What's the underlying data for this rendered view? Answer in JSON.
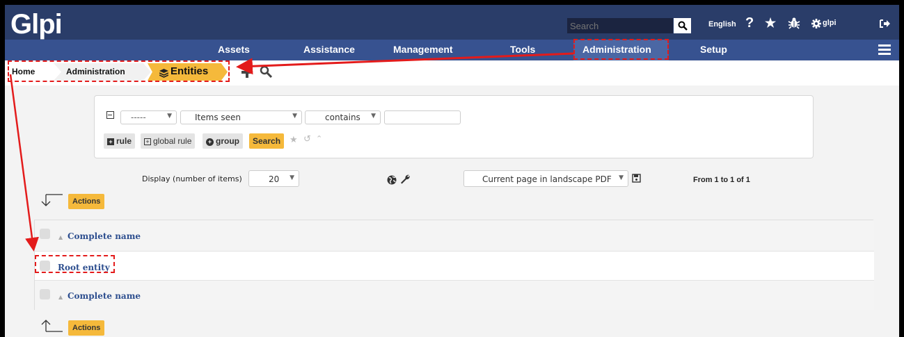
{
  "app": {
    "logo": "Glpi",
    "logo_g": "G",
    "logo_rest": "lpi"
  },
  "top": {
    "search_placeholder": "Search",
    "language": "English",
    "help": "?",
    "user": "glpi"
  },
  "menu": [
    "Assets",
    "Assistance",
    "Management",
    "Tools",
    "Administration",
    "Setup"
  ],
  "breadcrumb": {
    "home": "Home",
    "admin": "Administration",
    "entities": "Entities"
  },
  "search": {
    "field1": "-----",
    "field2": "Items seen",
    "operator": "contains",
    "value": "",
    "btn_rule": "rule",
    "btn_global_rule": "global rule",
    "btn_group": "group",
    "btn_search": "Search"
  },
  "display": {
    "label": "Display (number of items)",
    "count": "20",
    "export": "Current page in landscape PDF",
    "pager": "From 1 to 1 of 1"
  },
  "actions": "Actions",
  "table": {
    "header": "Complete name",
    "rows": [
      "Root entity"
    ],
    "footer": "Complete name"
  },
  "colors": {
    "topbar": "#2a3d69",
    "navbar": "#375290",
    "accent": "#f5b93b",
    "annotation": "#e31b1b"
  }
}
